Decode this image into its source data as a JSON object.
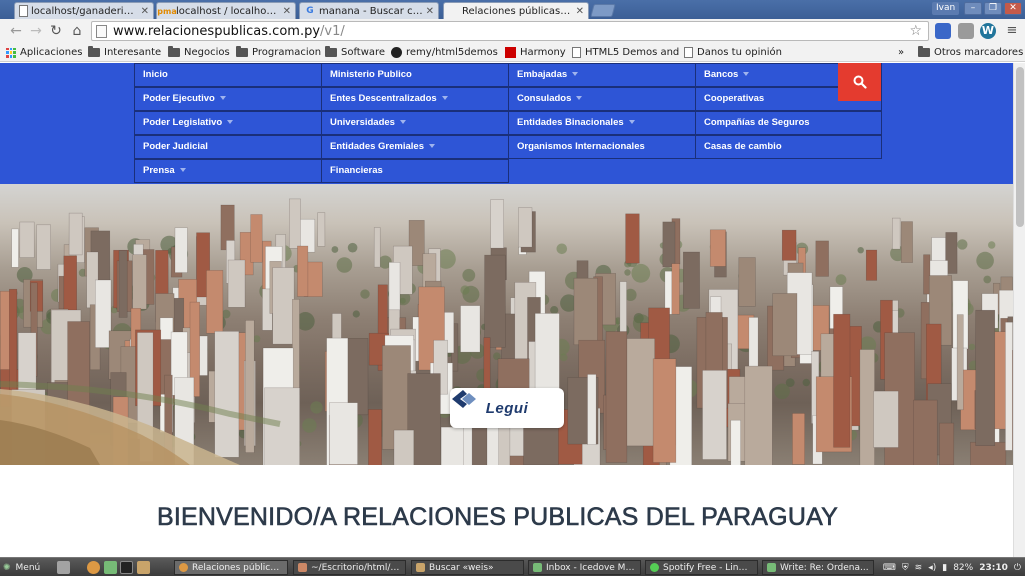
{
  "browser": {
    "tabs": [
      {
        "label": "localhost/ganaderia/fc",
        "icon": "page-icon"
      },
      {
        "label": "localhost / localhost /",
        "icon": "phpmyadmin-icon"
      },
      {
        "label": "manana - Buscar con",
        "icon": "google-icon"
      },
      {
        "label": "Relaciones públicas - L",
        "icon": "page-icon",
        "active": true
      }
    ],
    "user": "Ivan",
    "url_host": "www.relacionespublicas.com.py",
    "url_path": "/v1/",
    "bookmarks": [
      {
        "label": "Aplicaciones",
        "icon": "apps-grid-icon"
      },
      {
        "label": "Interesante",
        "icon": "folder-icon"
      },
      {
        "label": "Negocios",
        "icon": "folder-icon"
      },
      {
        "label": "Programacion",
        "icon": "folder-icon"
      },
      {
        "label": "Software",
        "icon": "folder-icon"
      },
      {
        "label": "remy/html5demos",
        "icon": "github-icon"
      },
      {
        "label": "Harmony",
        "icon": "harmony-icon"
      },
      {
        "label": "HTML5 Demos and",
        "icon": "document-icon"
      },
      {
        "label": "Danos tu opinión",
        "icon": "document-icon"
      }
    ],
    "overflow_label": "»",
    "other_bookmarks": "Otros marcadores"
  },
  "site": {
    "menu": [
      [
        {
          "label": "Inicio",
          "dropdown": false
        },
        {
          "label": "Poder Ejecutivo",
          "dropdown": true
        },
        {
          "label": "Poder Legislativo",
          "dropdown": true
        },
        {
          "label": "Poder Judicial",
          "dropdown": false
        },
        {
          "label": "Prensa",
          "dropdown": true
        }
      ],
      [
        {
          "label": "Ministerio Publico",
          "dropdown": false
        },
        {
          "label": "Entes Descentralizados",
          "dropdown": true
        },
        {
          "label": "Universidades",
          "dropdown": true
        },
        {
          "label": "Entidades Gremiales",
          "dropdown": true
        },
        {
          "label": "Financieras",
          "dropdown": false
        }
      ],
      [
        {
          "label": "Embajadas",
          "dropdown": true
        },
        {
          "label": "Consulados",
          "dropdown": true
        },
        {
          "label": "Entidades Binacionales",
          "dropdown": true
        },
        {
          "label": "Organismos Internacionales",
          "dropdown": false
        }
      ],
      [
        {
          "label": "Bancos",
          "dropdown": true
        },
        {
          "label": "Cooperativas",
          "dropdown": false
        },
        {
          "label": "Compañías de Seguros",
          "dropdown": false
        },
        {
          "label": "Casas de cambio",
          "dropdown": false
        }
      ]
    ],
    "logo_text": "Legui",
    "welcome": "BIENVENIDO/A RELACIONES PUBLICAS DEL PARAGUAY",
    "colors": {
      "menu_bg": "#2e55d6",
      "search_btn": "#e43b2f",
      "heading": "#2d3a4a"
    }
  },
  "taskbar": {
    "menu_label": "Menú",
    "tasks": [
      {
        "label": "Relaciones públicas...",
        "active": true
      },
      {
        "label": "~/Escritorio/html/g..."
      },
      {
        "label": "Buscar «weis»"
      },
      {
        "label": "Inbox - Icedove Mai..."
      },
      {
        "label": "Spotify Free - Linux..."
      },
      {
        "label": "Write: Re: Ordena..."
      }
    ],
    "battery": "82%",
    "clock": "23:10"
  }
}
